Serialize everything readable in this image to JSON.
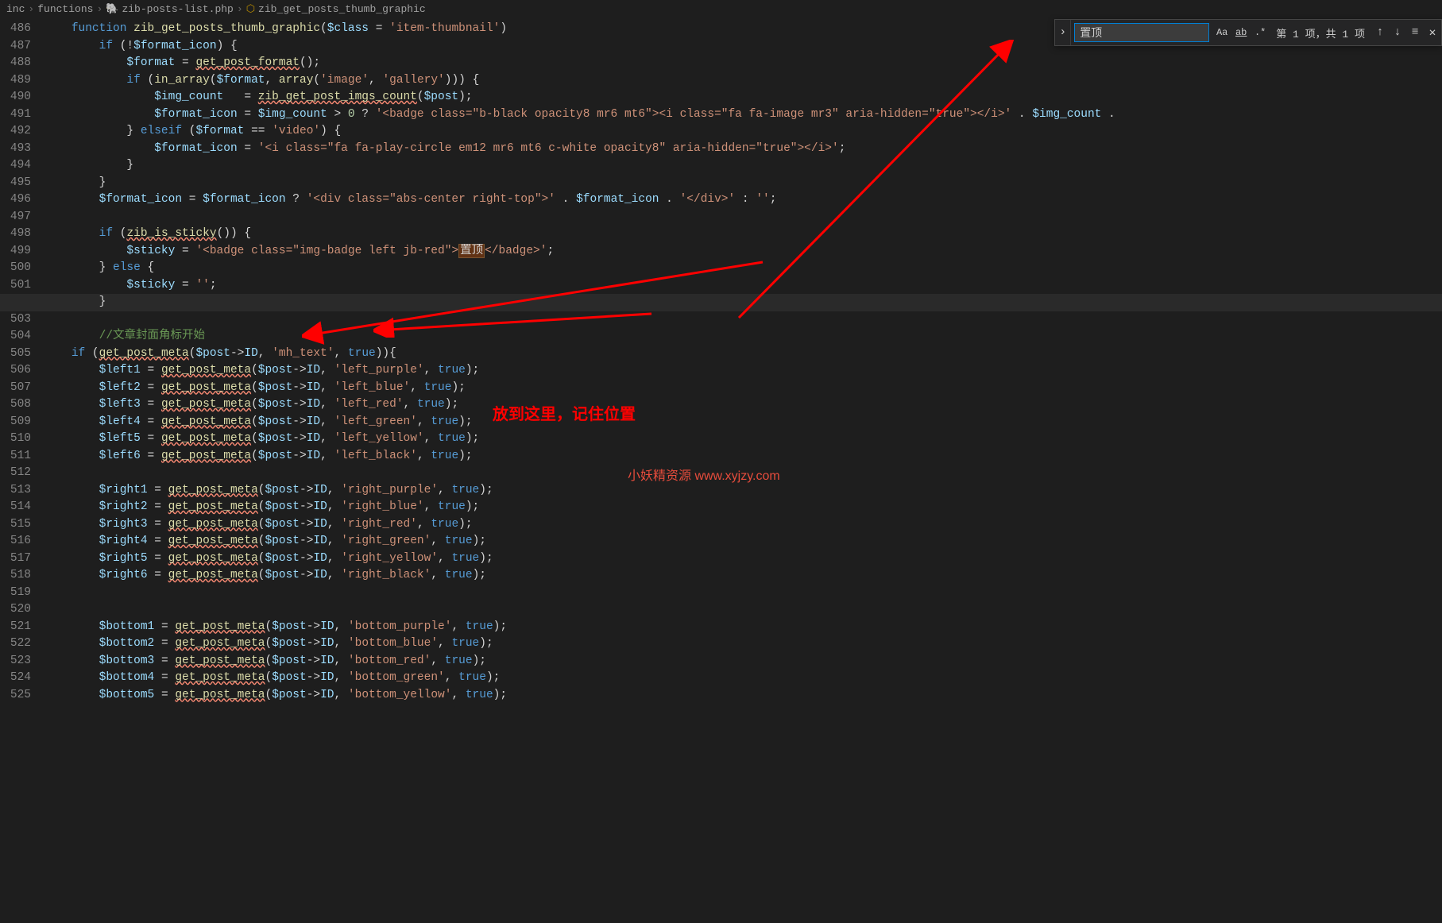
{
  "breadcrumb": {
    "p1": "inc",
    "p2": "functions",
    "p3": "zib-posts-list.php",
    "p4": "zib_get_posts_thumb_graphic"
  },
  "find": {
    "value": "置顶",
    "status": "第 1 项，共 1 项",
    "optCase": "Aa",
    "optWord": "ab",
    "optRegex": ".*"
  },
  "gutterStart": 486,
  "lines": {
    "l486": {
      "a": "function ",
      "b": "zib_get_posts_thumb_graphic",
      "c": "(",
      "d": "$class",
      "e": " = ",
      "f": "'item-thumbnail'",
      "g": ")"
    },
    "l487": {
      "a": "        ",
      "b": "if ",
      "c": "(!",
      "d": "$format_icon",
      "e": ") {"
    },
    "l488": {
      "a": "            ",
      "b": "$format",
      "c": " = ",
      "d": "get_post_format",
      "e": "();"
    },
    "l489": {
      "a": "            ",
      "b": "if ",
      "c": "(",
      "d": "in_array",
      "e": "(",
      "f": "$format",
      "g": ", ",
      "h": "array",
      "i": "(",
      "j": "'image'",
      "k": ", ",
      "l": "'gallery'",
      "m": "))) {"
    },
    "l490": {
      "a": "                ",
      "b": "$img_count",
      "c": "   = ",
      "d": "zib_get_post_imgs_count",
      "e": "(",
      "f": "$post",
      "g": ");"
    },
    "l491": {
      "a": "                ",
      "b": "$format_icon",
      "c": " = ",
      "d": "$img_count",
      "e": " > ",
      "f": "0",
      "g": " ? ",
      "h": "'<badge class=\"b-black opacity8 mr6 mt6\"><i class=\"fa fa-image mr3\" aria-hidden=\"true\"></i>'",
      "i": " . ",
      "j": "$img_count",
      "k": " ."
    },
    "l492": {
      "a": "            } ",
      "b": "elseif ",
      "c": "(",
      "d": "$format",
      "e": " == ",
      "f": "'video'",
      "g": ") {"
    },
    "l493": {
      "a": "                ",
      "b": "$format_icon",
      "c": " = ",
      "d": "'<i class=\"fa fa-play-circle em12 mr6 mt6 c-white opacity8\" aria-hidden=\"true\"></i>'",
      "e": ";"
    },
    "l494": {
      "a": "            }"
    },
    "l495": {
      "a": "        }"
    },
    "l496": {
      "a": "        ",
      "b": "$format_icon",
      "c": " = ",
      "d": "$format_icon",
      "e": " ? ",
      "f": "'<div class=\"abs-center right-top\">'",
      "g": " . ",
      "h": "$format_icon",
      "i": " . ",
      "j": "'</div>'",
      "k": " : ",
      "l": "''",
      "m": ";"
    },
    "l498": {
      "a": "        ",
      "b": "if ",
      "c": "(",
      "d": "zib_is_sticky",
      "e": "()) {"
    },
    "l499": {
      "a": "            ",
      "b": "$sticky",
      "c": " = ",
      "d": "'<badge class=\"img-badge left jb-red\">",
      "hl": "置顶",
      "e": "</badge>'",
      "f": ";"
    },
    "l500": {
      "a": "        } ",
      "b": "else ",
      "c": "{"
    },
    "l501": {
      "a": "            ",
      "b": "$sticky",
      "c": " = ",
      "d": "''",
      "e": ";"
    },
    "l502": {
      "a": "        }"
    },
    "l504": {
      "a": "        ",
      "b": "//文章封面角标开始"
    },
    "l505": {
      "a": "    ",
      "b": "if ",
      "c": "(",
      "d": "get_post_meta",
      "e": "(",
      "f": "$post",
      "g": "->",
      "h": "ID",
      "i": ", ",
      "j": "'mh_text'",
      "k": ", ",
      "l": "true",
      "m": ")){"
    },
    "l506": {
      "v": "$left1",
      "m": "'left_purple'"
    },
    "l507": {
      "v": "$left2",
      "m": "'left_blue'"
    },
    "l508": {
      "v": "$left3",
      "m": "'left_red'"
    },
    "l509": {
      "v": "$left4",
      "m": "'left_green'"
    },
    "l510": {
      "v": "$left5",
      "m": "'left_yellow'"
    },
    "l511": {
      "v": "$left6",
      "m": "'left_black'"
    },
    "l513": {
      "v": "$right1",
      "m": "'right_purple'"
    },
    "l514": {
      "v": "$right2",
      "m": "'right_blue'"
    },
    "l515": {
      "v": "$right3",
      "m": "'right_red'"
    },
    "l516": {
      "v": "$right4",
      "m": "'right_green'"
    },
    "l517": {
      "v": "$right5",
      "m": "'right_yellow'"
    },
    "l518": {
      "v": "$right6",
      "m": "'right_black'"
    },
    "l521": {
      "v": "$bottom1",
      "m": "'bottom_purple'"
    },
    "l522": {
      "v": "$bottom2",
      "m": "'bottom_blue'"
    },
    "l523": {
      "v": "$bottom3",
      "m": "'bottom_red'"
    },
    "l524": {
      "v": "$bottom4",
      "m": "'bottom_green'"
    },
    "l525": {
      "v": "$bottom5",
      "m": "'bottom_yellow'"
    }
  },
  "annot": {
    "main": "放到这里，记住位置",
    "watermark": "小妖精资源 www.xyjzy.com"
  }
}
